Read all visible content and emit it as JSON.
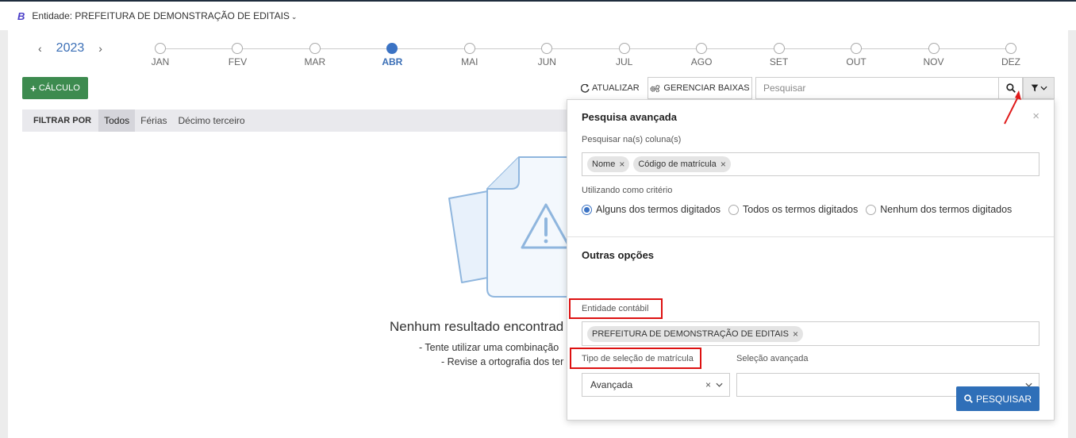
{
  "header": {
    "logo": "B",
    "entity_label": "Entidade: PREFEITURA DE DEMONSTRAÇÃO DE EDITAIS",
    "chevron": "⌄"
  },
  "year_nav": {
    "prev": "‹",
    "year": "2023",
    "next": "›"
  },
  "months": [
    "JAN",
    "FEV",
    "MAR",
    "ABR",
    "MAI",
    "JUN",
    "JUL",
    "AGO",
    "SET",
    "OUT",
    "NOV",
    "DEZ"
  ],
  "active_month": "ABR",
  "toolbar": {
    "calc_label": "CÁLCULO",
    "refresh_label": "ATUALIZAR",
    "manage_label": "GERENCIAR BAIXAS",
    "search_placeholder": "Pesquisar"
  },
  "filter": {
    "label": "FILTRAR POR",
    "items": [
      "Todos",
      "Férias",
      "Décimo terceiro"
    ],
    "selected": "Todos"
  },
  "empty_state": {
    "title": "Nenhum resultado encontrad",
    "tip1": "- Tente utilizar uma combinação",
    "tip2": "- Revise a ortografia dos ter"
  },
  "advanced_search": {
    "title": "Pesquisa avançada",
    "close": "×",
    "columns_label": "Pesquisar na(s) coluna(s)",
    "columns_tags": [
      "Nome",
      "Código de matrícula"
    ],
    "criteria_label": "Utilizando como critério",
    "criteria_options": [
      "Alguns dos termos digitados",
      "Todos os termos digitados",
      "Nenhum dos termos digitados"
    ],
    "criteria_selected": "Alguns dos termos digitados",
    "other_title": "Outras opções",
    "entity_label": "Entidade contábil",
    "entity_tag": "PREFEITURA DE DEMONSTRAÇÃO DE EDITAIS",
    "selection_type_label": "Tipo de seleção de matrícula",
    "selection_type_value": "Avançada",
    "advanced_selection_label": "Seleção avançada",
    "advanced_selection_value": "",
    "search_button": "PESQUISAR"
  },
  "colors": {
    "accent_blue": "#3b73c4",
    "calc_green": "#3d8b4f",
    "search_button_blue": "#2f6fb8",
    "highlight_red": "#dd1111"
  }
}
